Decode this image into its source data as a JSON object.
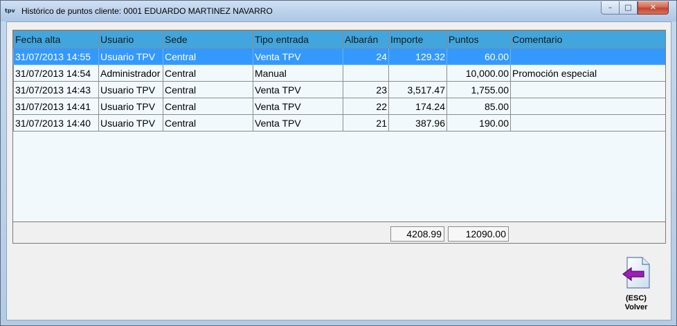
{
  "window": {
    "app_icon": "tpv",
    "title": "Histórico de puntos cliente: 0001 EDUARDO MARTINEZ NAVARRO",
    "controls": {
      "minimize": "–",
      "maximize": "□",
      "close": "✕"
    }
  },
  "table": {
    "columns": [
      "Fecha alta",
      "Usuario",
      "Sede",
      "Tipo entrada",
      "Albarán",
      "Importe",
      "Puntos",
      "Comentario"
    ],
    "rows": [
      {
        "fecha": "31/07/2013 14:55",
        "usuario": "Usuario TPV",
        "sede": "Central",
        "tipo": "Venta TPV",
        "albaran": "24",
        "importe": "129.32",
        "puntos": "60.00",
        "comentario": "",
        "selected": true
      },
      {
        "fecha": "31/07/2013 14:54",
        "usuario": "Administrador",
        "sede": "Central",
        "tipo": "Manual",
        "albaran": "",
        "importe": "",
        "puntos": "10,000.00",
        "comentario": "Promoción especial",
        "selected": false
      },
      {
        "fecha": "31/07/2013 14:43",
        "usuario": "Usuario TPV",
        "sede": "Central",
        "tipo": "Venta TPV",
        "albaran": "23",
        "importe": "3,517.47",
        "puntos": "1,755.00",
        "comentario": "",
        "selected": false
      },
      {
        "fecha": "31/07/2013 14:41",
        "usuario": "Usuario TPV",
        "sede": "Central",
        "tipo": "Venta TPV",
        "albaran": "22",
        "importe": "174.24",
        "puntos": "85.00",
        "comentario": "",
        "selected": false
      },
      {
        "fecha": "31/07/2013 14:40",
        "usuario": "Usuario TPV",
        "sede": "Central",
        "tipo": "Venta TPV",
        "albaran": "21",
        "importe": "387.96",
        "puntos": "190.00",
        "comentario": "",
        "selected": false
      }
    ]
  },
  "totals": {
    "importe": "4208.99",
    "puntos": "12090.00"
  },
  "back_button": {
    "shortcut": "(ESC)",
    "label": "Volver",
    "icon": "back-arrow-document-icon"
  },
  "colors": {
    "header_bg": "#41a6de",
    "selected_row_bg": "#3399ff",
    "grid_bg": "#f2f9fc",
    "arrow": "#9b1fb8"
  }
}
